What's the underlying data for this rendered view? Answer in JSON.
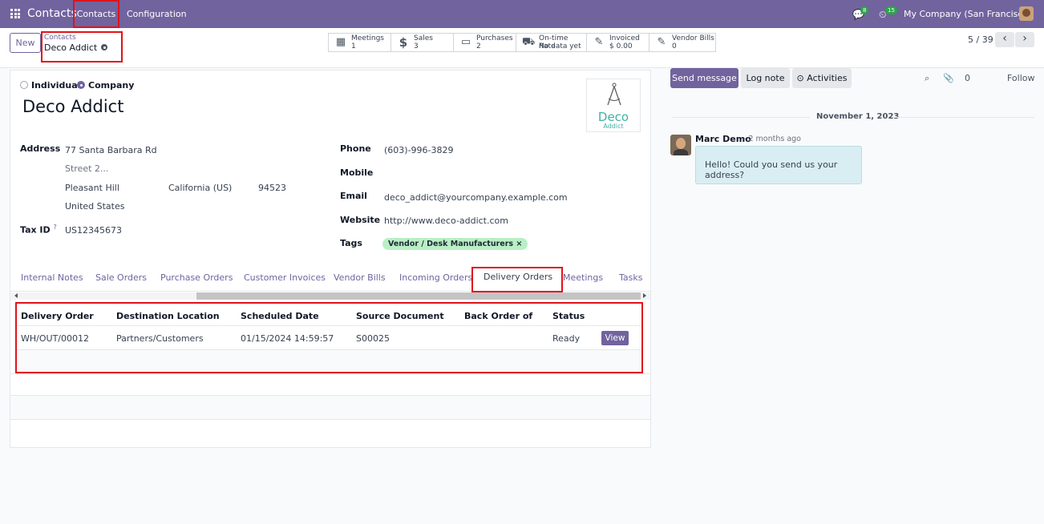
{
  "navbar": {
    "brand": "Contacts",
    "menu": [
      "Contacts",
      "Configuration"
    ],
    "messages_count": "8",
    "activities_count": "15",
    "company": "My Company (San Francisco)"
  },
  "control": {
    "new_label": "New",
    "breadcrumb_parent": "Contacts",
    "breadcrumb_current": "Deco Addict",
    "stats": [
      {
        "icon": "calendar-icon",
        "label": "Meetings",
        "value": "1"
      },
      {
        "icon": "dollar-icon",
        "label": "Sales",
        "value": "3"
      },
      {
        "icon": "credit-card-icon",
        "label": "Purchases",
        "value": "2"
      },
      {
        "icon": "truck-icon",
        "label": "On-time Rate",
        "value": "No data yet"
      },
      {
        "icon": "edit-icon",
        "label": "Invoiced",
        "value": "$ 0.00"
      },
      {
        "icon": "edit-icon",
        "label": "Vendor Bills",
        "value": "0"
      }
    ],
    "pager": "5 / 39"
  },
  "form": {
    "type_options": [
      "Individual",
      "Company"
    ],
    "selected_type": "Company",
    "name": "Deco Addict",
    "logo_line1": "Deco",
    "logo_line2": "Addict",
    "address_label": "Address",
    "street": "77 Santa Barbara Rd",
    "street2_placeholder": "Street 2...",
    "city": "Pleasant Hill",
    "state": "California (US)",
    "zip": "94523",
    "country": "United States",
    "tax_id_label": "Tax ID",
    "tax_id_help": "?",
    "tax_id": "US12345673",
    "phone_label": "Phone",
    "phone": "(603)-996-3829",
    "mobile_label": "Mobile",
    "email_label": "Email",
    "email": "deco_addict@yourcompany.example.com",
    "website_label": "Website",
    "website": "http://www.deco-addict.com",
    "tags_label": "Tags",
    "tag": "Vendor / Desk Manufacturers",
    "tag_remove": "×"
  },
  "tabs": [
    "Internal Notes",
    "Sale Orders",
    "Purchase Orders",
    "Customer Invoices",
    "Vendor Bills",
    "Incoming Orders",
    "Delivery Orders",
    "Meetings",
    "Tasks"
  ],
  "active_tab": "Delivery Orders",
  "table": {
    "headers": [
      "Delivery Order",
      "Destination Location",
      "Scheduled Date",
      "Source Document",
      "Back Order of",
      "Status"
    ],
    "rows": [
      {
        "delivery_order": "WH/OUT/00012",
        "destination": "Partners/Customers",
        "scheduled_date": "01/15/2024 14:59:57",
        "source": "S00025",
        "back_order_of": "",
        "status": "Ready",
        "action": "View"
      }
    ]
  },
  "chatter": {
    "send_message": "Send message",
    "log_note": "Log note",
    "activities": "Activities",
    "attachments_count": "0",
    "follow": "Follow",
    "date_separator": "November 1, 2023",
    "message": {
      "author": "Marc Demo",
      "time": "- 2 months ago",
      "body": "Hello! Could you send us your address?"
    }
  },
  "colors": {
    "brand": "#71639e",
    "highlight": "#e0131a",
    "tag_bg": "#b9efc4",
    "bubble_bg": "#d9eef2"
  }
}
